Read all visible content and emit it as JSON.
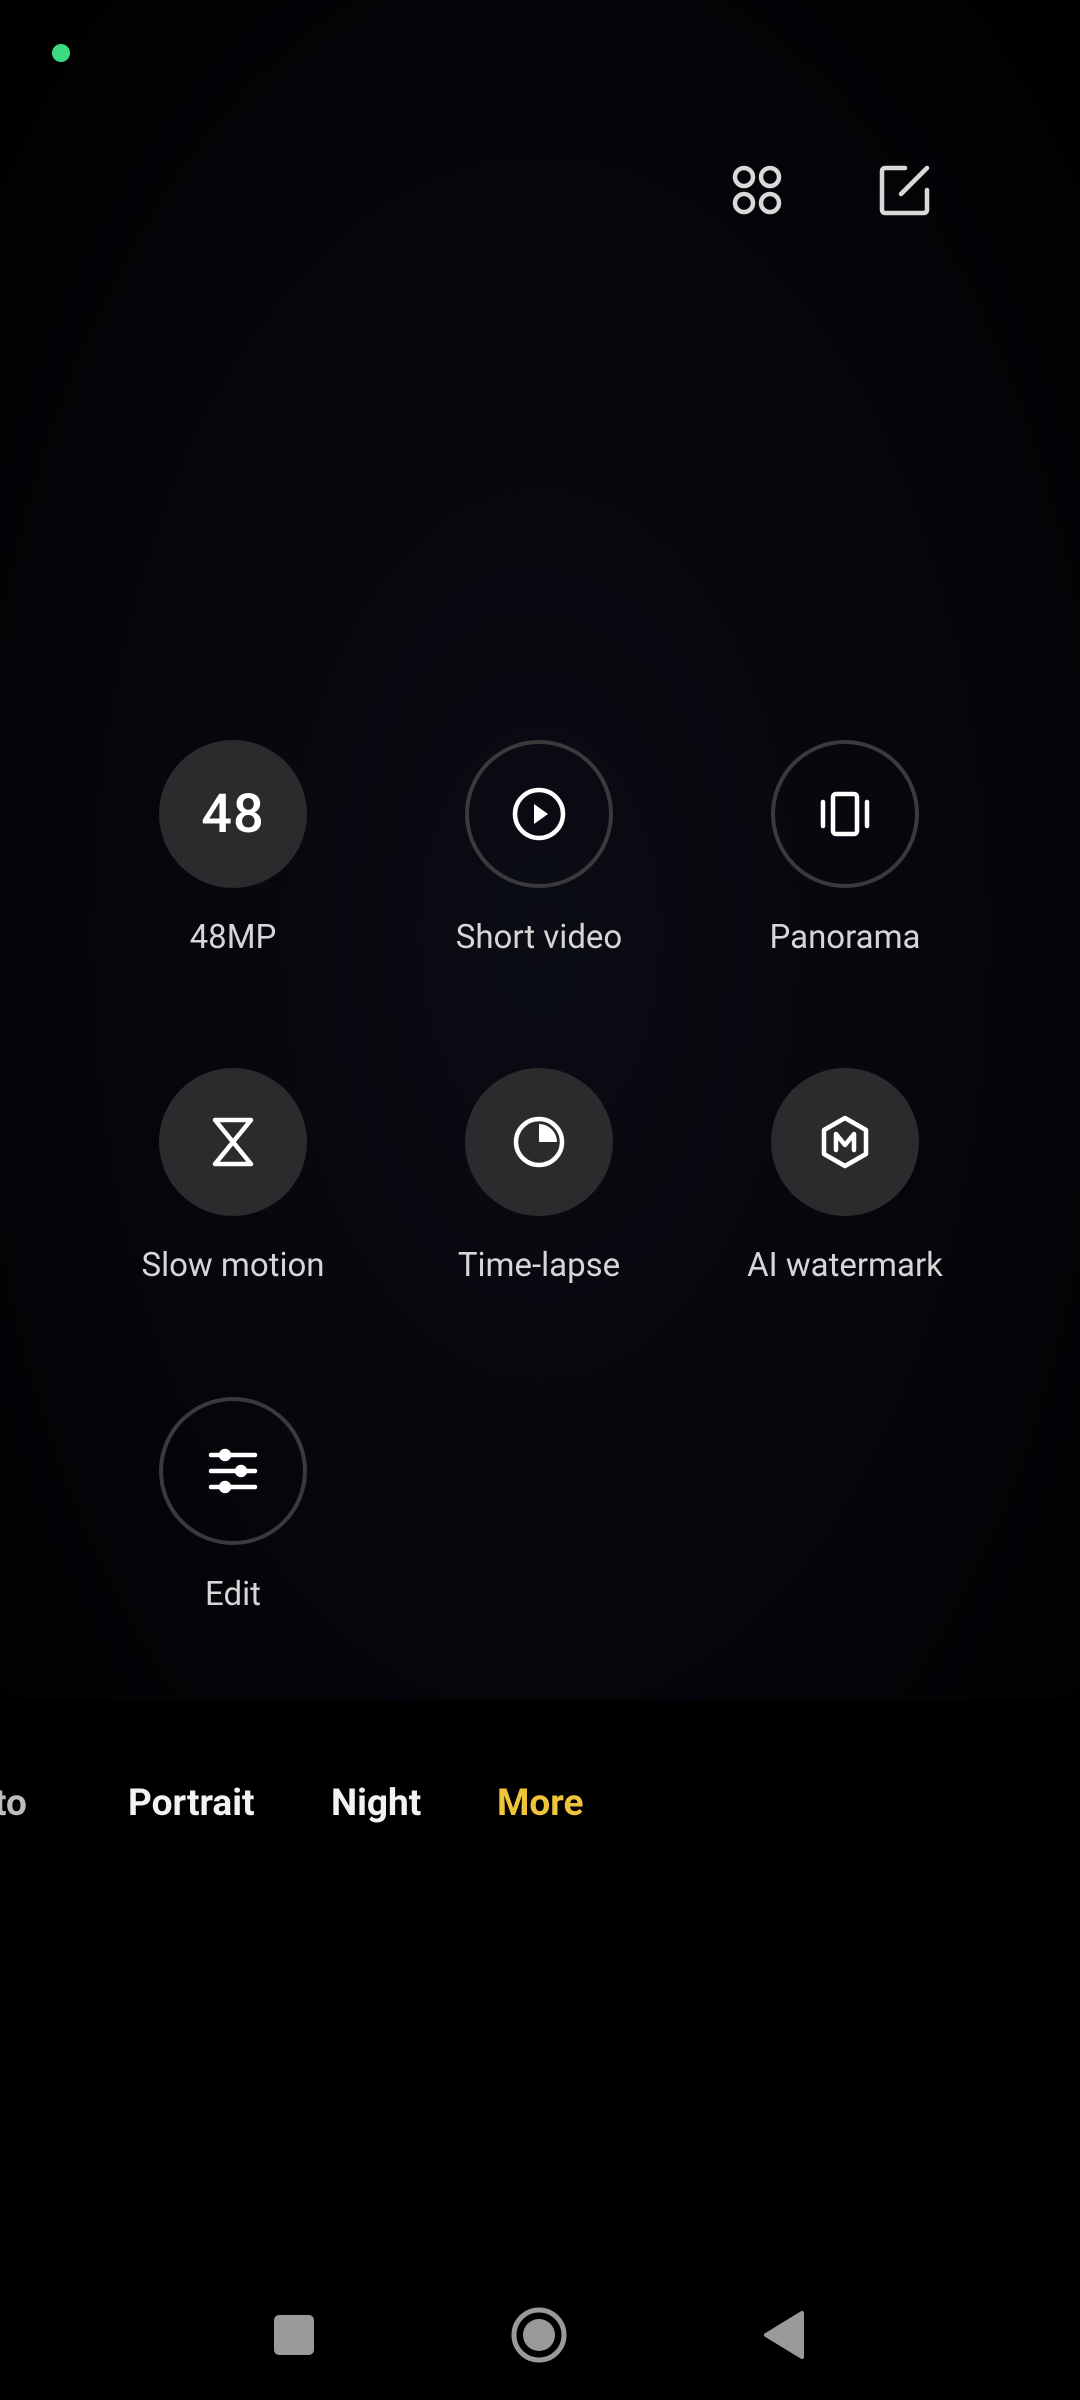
{
  "top_bar": {
    "icons": [
      "grid-icon",
      "edit-icon"
    ]
  },
  "modes": [
    {
      "label": "48MP",
      "icon": "48",
      "style": "filled"
    },
    {
      "label": "Short video",
      "icon": "play-icon",
      "style": "outline"
    },
    {
      "label": "Panorama",
      "icon": "panorama-icon",
      "style": "outline"
    },
    {
      "label": "Slow motion",
      "icon": "hourglass-icon",
      "style": "filled"
    },
    {
      "label": "Time-lapse",
      "icon": "clock-icon",
      "style": "filled"
    },
    {
      "label": "AI watermark",
      "icon": "watermark-icon",
      "style": "filled"
    },
    {
      "label": "Edit",
      "icon": "sliders-icon",
      "style": "outline"
    }
  ],
  "mode_bar": {
    "tabs": [
      "to",
      "Portrait",
      "Night",
      "More"
    ],
    "active": "More",
    "active_color": "#f0c43a"
  },
  "nav_bar": {
    "icons": [
      "recents-icon",
      "home-icon",
      "back-icon"
    ]
  },
  "colors": {
    "status_dot": "#3ddc84",
    "accent": "#f0c43a"
  }
}
